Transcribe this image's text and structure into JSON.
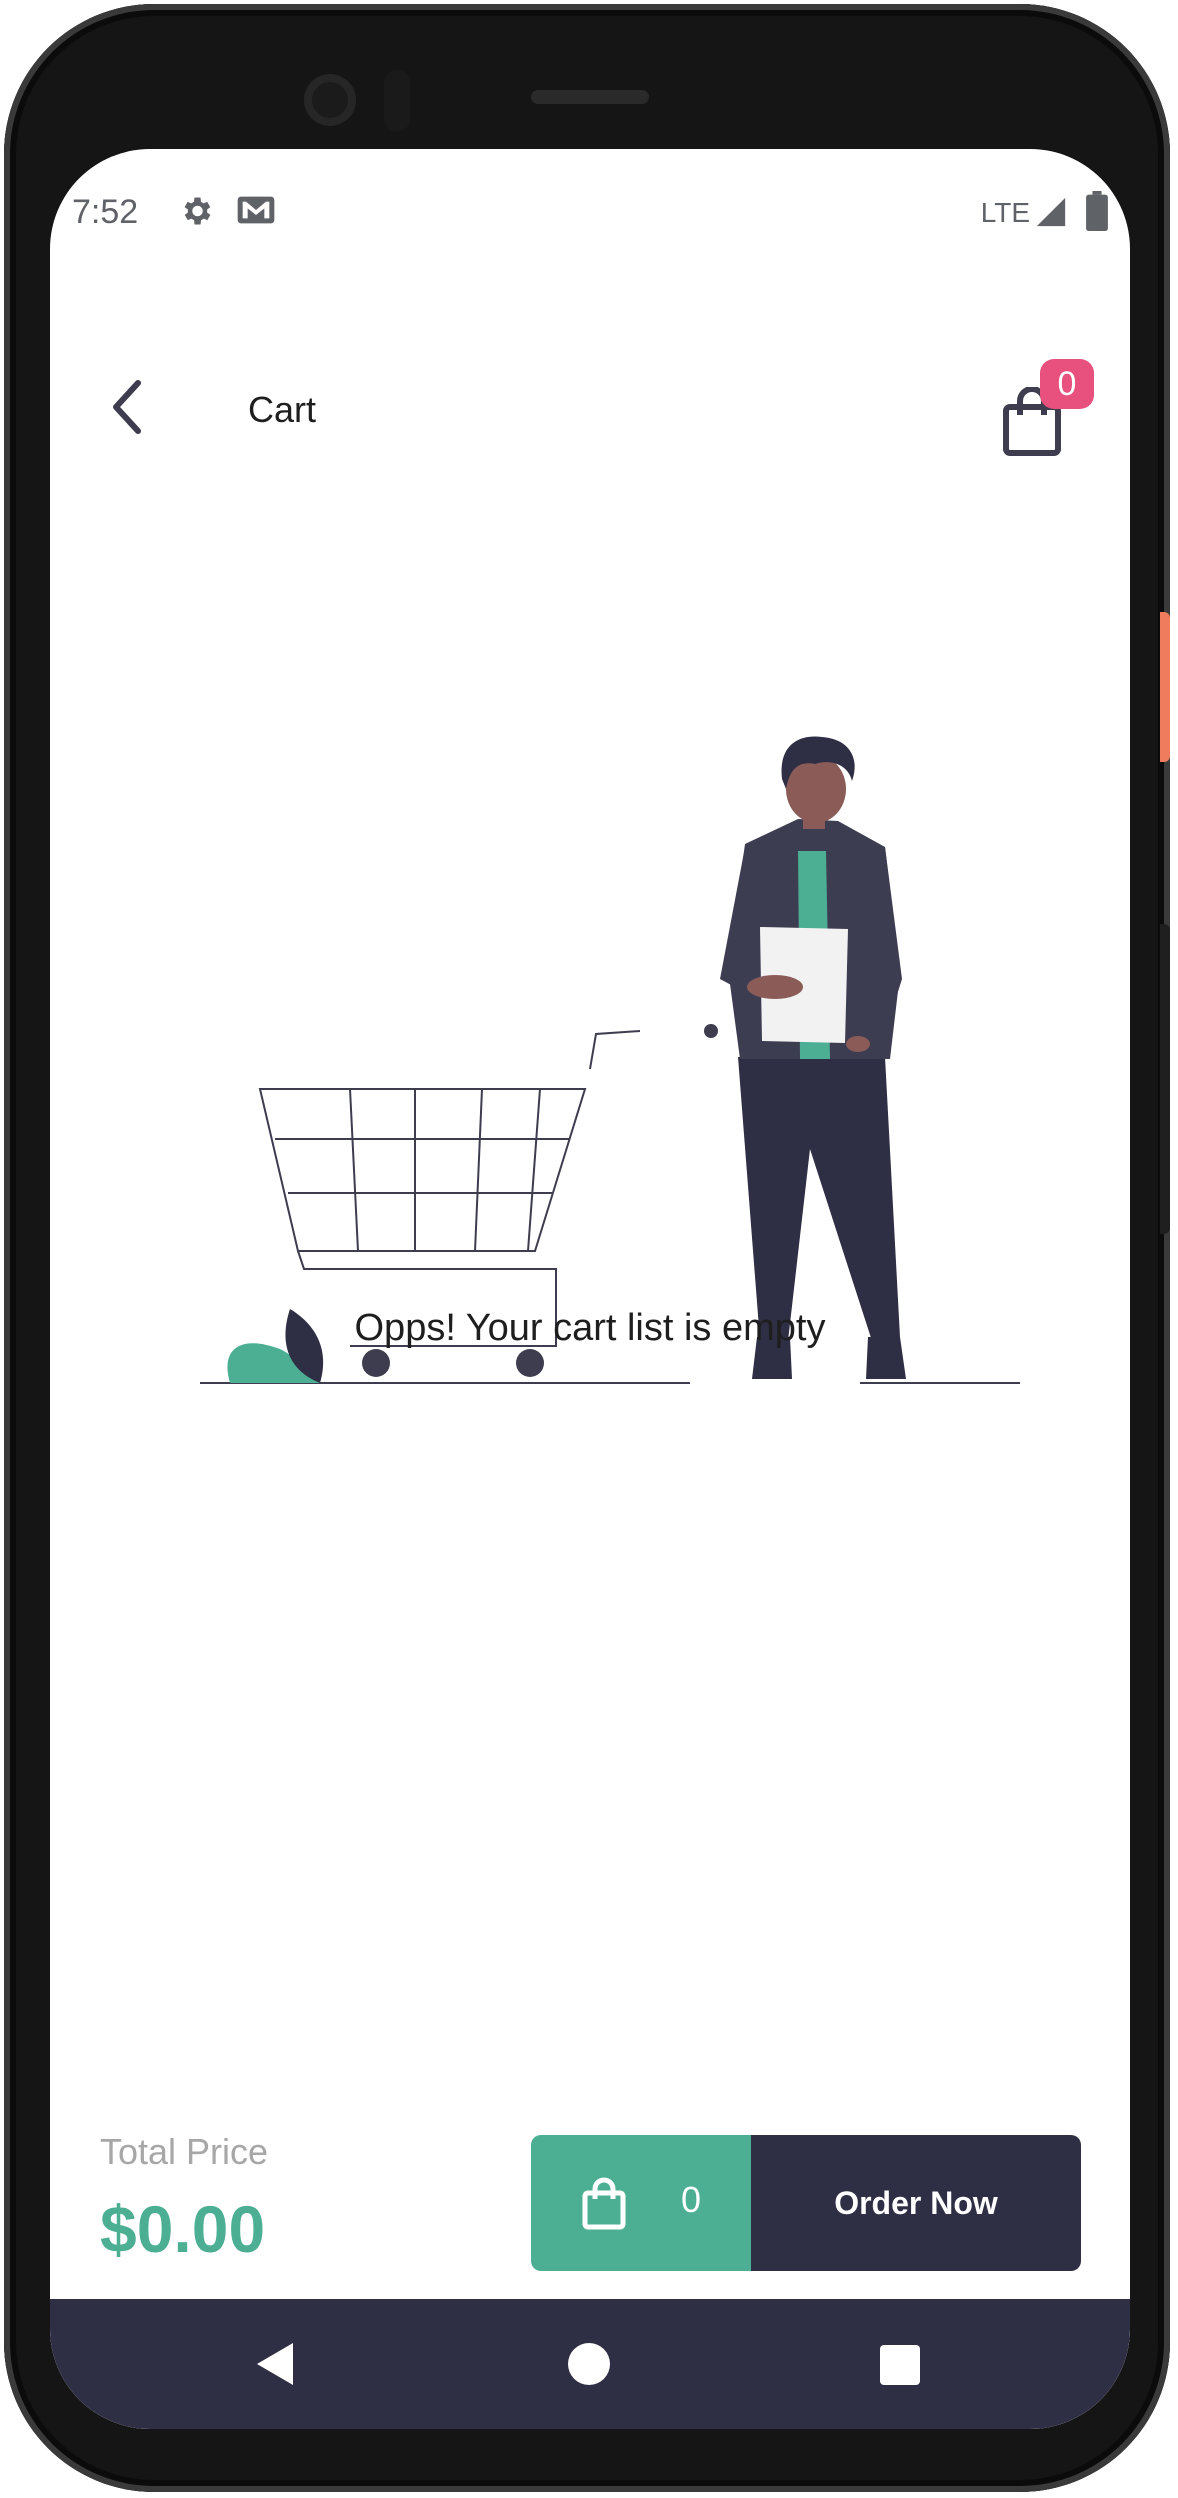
{
  "status_bar": {
    "time": "7:52",
    "network": "LTE",
    "icons": [
      "gear-icon",
      "gmail-icon",
      "signal-icon",
      "battery-icon"
    ]
  },
  "app_bar": {
    "title": "Cart",
    "cart_badge_count": "0",
    "icons": [
      "chevron-left-icon",
      "shopping-bag-icon"
    ]
  },
  "empty_state": {
    "message": "Opps! Your cart list is empty"
  },
  "footer": {
    "total_label": "Total Price",
    "total_value": "$0.00",
    "item_count": "0",
    "order_button_label": "Order Now"
  },
  "colors": {
    "accent_green": "#4caf93",
    "dark_navy": "#2e2e44",
    "badge_pink": "#e8507e"
  }
}
